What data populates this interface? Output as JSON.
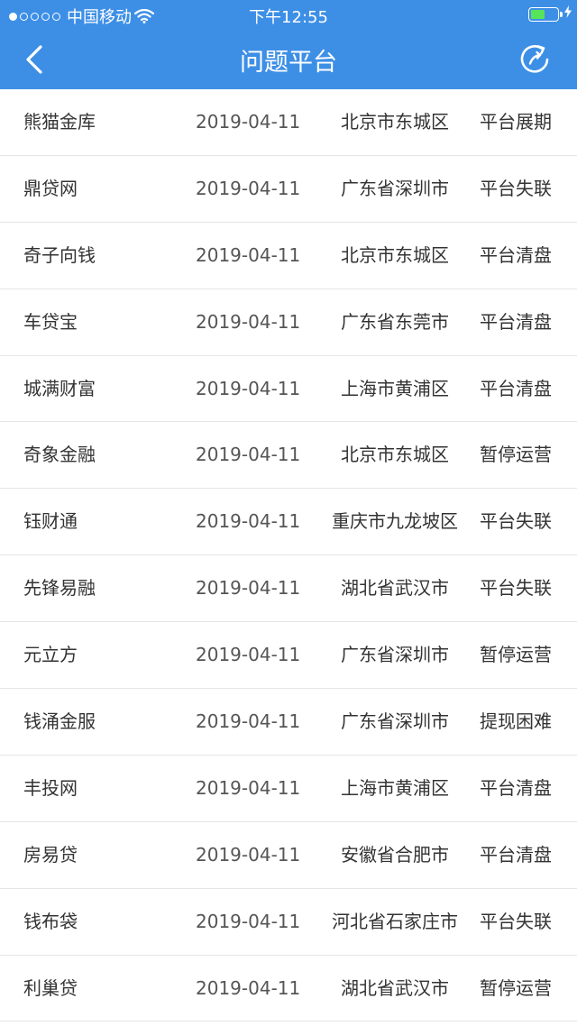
{
  "status_bar": {
    "carrier": "中国移动",
    "time": "下午12:55",
    "battery_level": 0.55,
    "signal_dots_filled": 1,
    "signal_dots_total": 5
  },
  "header": {
    "title": "问题平台",
    "back_icon": "chevron-left-icon",
    "refresh_icon": "refresh-icon"
  },
  "colors": {
    "header_bg": "#3d8fe6",
    "battery_fill": "#57e35a",
    "divider": "#e6e6e6"
  },
  "platforms": [
    {
      "name": "熊猫金库",
      "date": "2019-04-11",
      "location": "北京市东城区",
      "status": "平台展期"
    },
    {
      "name": "鼎贷网",
      "date": "2019-04-11",
      "location": "广东省深圳市",
      "status": "平台失联"
    },
    {
      "name": "奇子向钱",
      "date": "2019-04-11",
      "location": "北京市东城区",
      "status": "平台清盘"
    },
    {
      "name": "车贷宝",
      "date": "2019-04-11",
      "location": "广东省东莞市",
      "status": "平台清盘"
    },
    {
      "name": "城满财富",
      "date": "2019-04-11",
      "location": "上海市黄浦区",
      "status": "平台清盘"
    },
    {
      "name": "奇象金融",
      "date": "2019-04-11",
      "location": "北京市东城区",
      "status": "暂停运营"
    },
    {
      "name": "钰财通",
      "date": "2019-04-11",
      "location": "重庆市九龙坡区",
      "status": "平台失联"
    },
    {
      "name": "先锋易融",
      "date": "2019-04-11",
      "location": "湖北省武汉市",
      "status": "平台失联"
    },
    {
      "name": "元立方",
      "date": "2019-04-11",
      "location": "广东省深圳市",
      "status": "暂停运营"
    },
    {
      "name": "钱涌金服",
      "date": "2019-04-11",
      "location": "广东省深圳市",
      "status": "提现困难"
    },
    {
      "name": "丰投网",
      "date": "2019-04-11",
      "location": "上海市黄浦区",
      "status": "平台清盘"
    },
    {
      "name": "房易贷",
      "date": "2019-04-11",
      "location": "安徽省合肥市",
      "status": "平台清盘"
    },
    {
      "name": "钱布袋",
      "date": "2019-04-11",
      "location": "河北省石家庄市",
      "status": "平台失联"
    },
    {
      "name": "利巢贷",
      "date": "2019-04-11",
      "location": "湖北省武汉市",
      "status": "暂停运营"
    }
  ]
}
